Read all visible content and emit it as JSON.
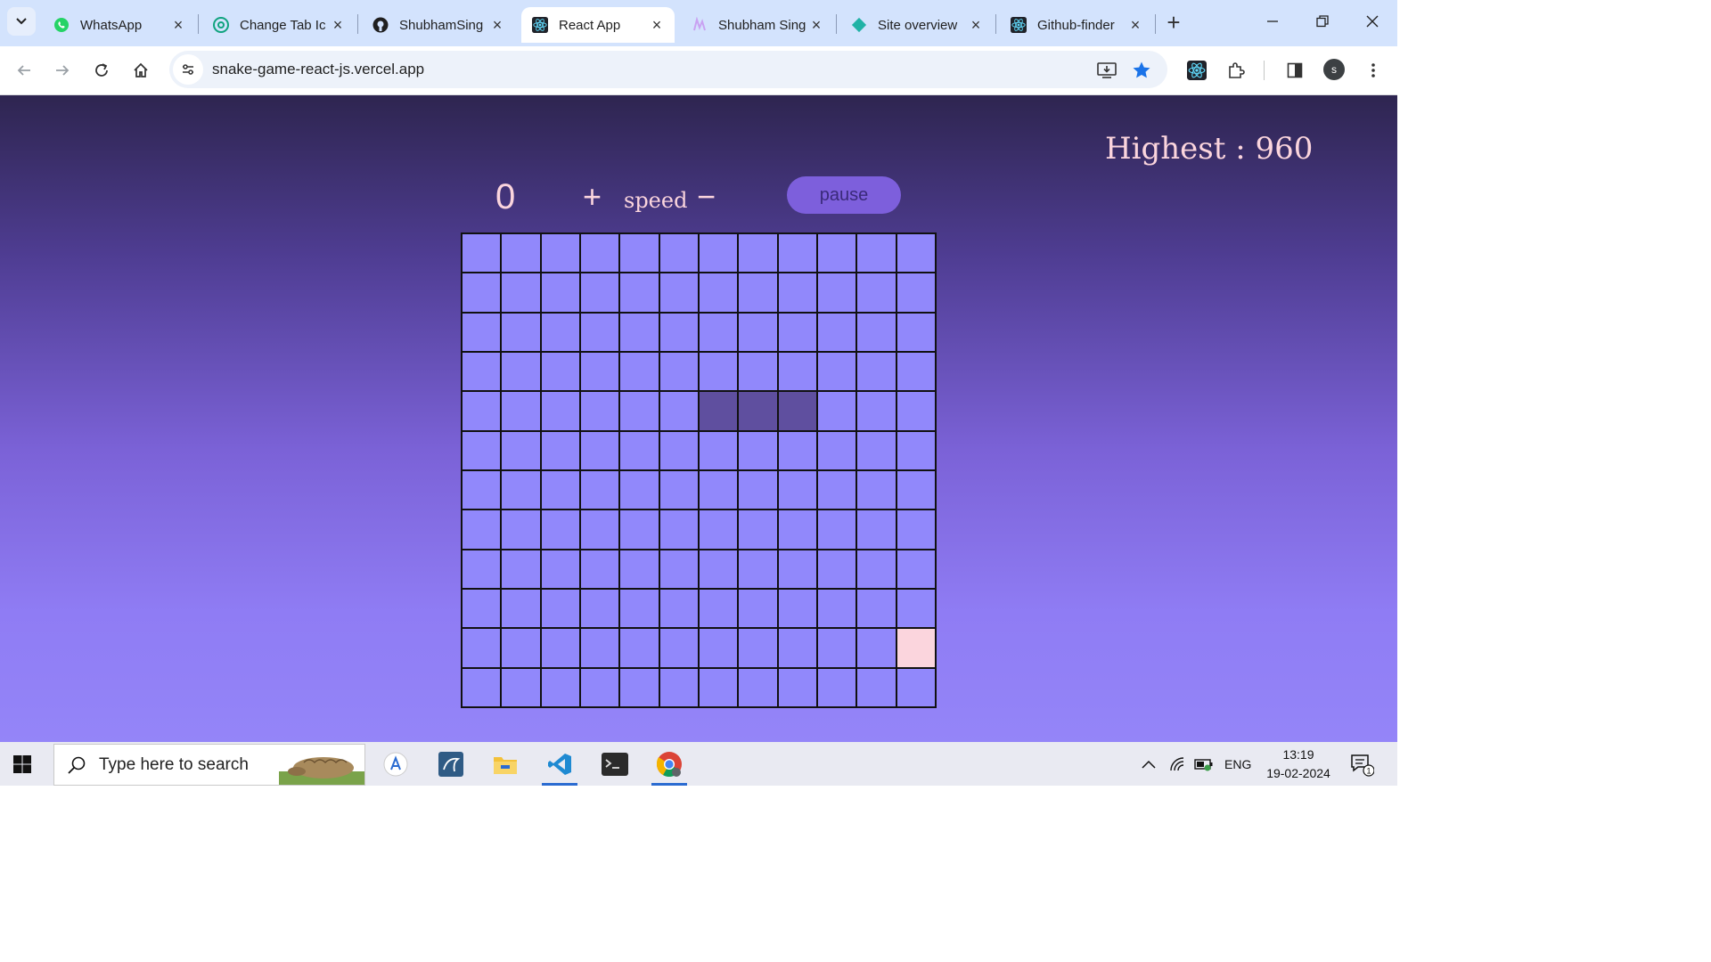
{
  "browser": {
    "tabs": [
      {
        "title": "WhatsApp",
        "icon": "whatsapp-icon",
        "active": false
      },
      {
        "title": "Change Tab Ic",
        "icon": "chatgpt-icon",
        "active": false
      },
      {
        "title": "ShubhamSing",
        "icon": "github-icon",
        "active": false
      },
      {
        "title": "React App",
        "icon": "react-icon",
        "active": true
      },
      {
        "title": "Shubham Sing",
        "icon": "portfolio-icon",
        "active": false
      },
      {
        "title": "Site overview",
        "icon": "netlify-icon",
        "active": false
      },
      {
        "title": "Github-finder",
        "icon": "react-icon",
        "active": false
      }
    ],
    "url": "snake-game-react-js.vercel.app",
    "profile_initial": "s"
  },
  "game": {
    "highest_label": "Highest : 960",
    "score": "0",
    "speed_plus": "+",
    "speed_label": "speed",
    "speed_minus": "−",
    "pause_label": "pause",
    "grid": {
      "rows": 12,
      "cols": 12,
      "snake": [
        [
          4,
          6
        ],
        [
          4,
          7
        ],
        [
          4,
          8
        ]
      ],
      "food": [
        10,
        11
      ]
    },
    "colors": {
      "cell": "#9188fb",
      "snake": "#5f4f9f",
      "food": "#fbd5dd",
      "text": "#fbd5dd",
      "button": "#7d5fdc"
    }
  },
  "taskbar": {
    "search_placeholder": "Type here to search",
    "language": "ENG",
    "time": "13:19",
    "date": "19-02-2024",
    "notification_count": "1"
  }
}
